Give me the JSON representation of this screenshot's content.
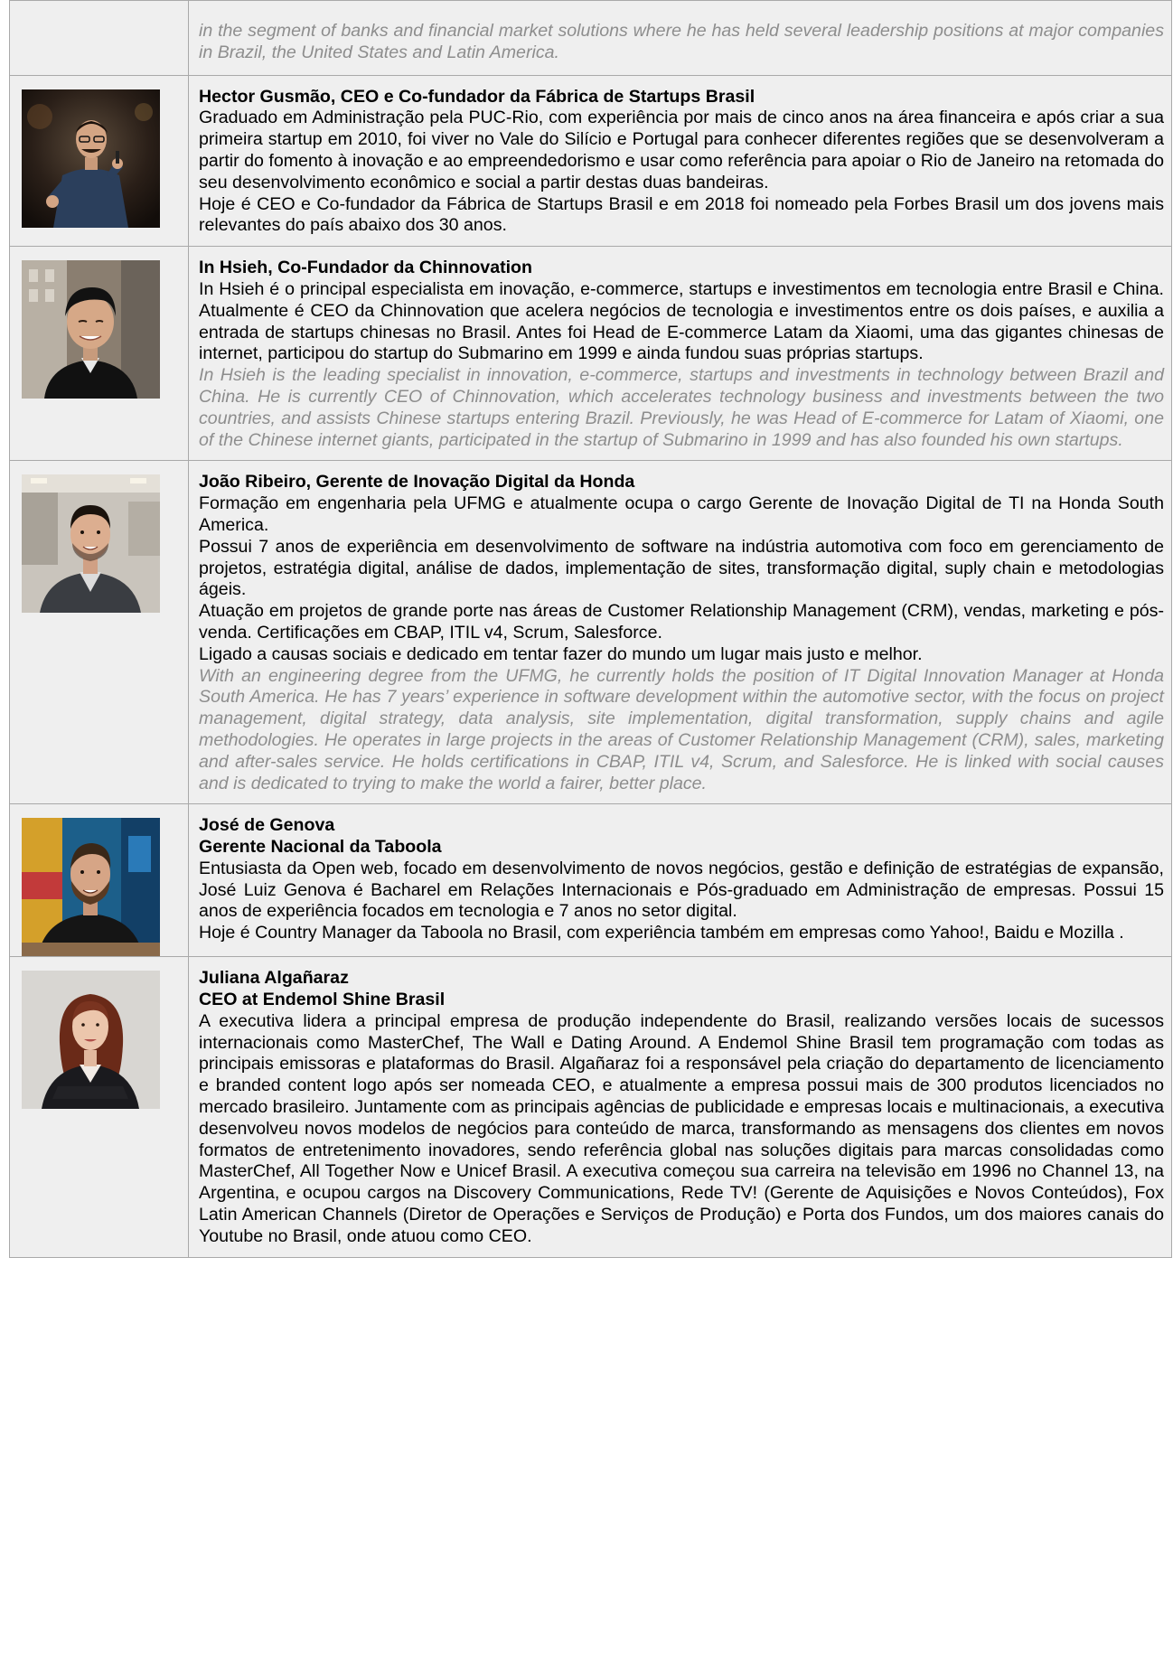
{
  "rows": [
    {
      "id": "continued",
      "english": "in the segment of banks and financial market solutions where he has held several leadership positions at major companies in Brazil, the United States and Latin America."
    },
    {
      "id": "hector",
      "photo": "person-portrait-hector",
      "name": "Hector Gusmão, CEO e Co-fundador da Fábrica de Startups Brasil",
      "bio": [
        "Graduado em Administração pela PUC-Rio, com experiência por mais de cinco anos na área financeira e após criar a sua primeira startup em 2010, foi viver no Vale do Silício e Portugal para conhecer diferentes regiões que se desenvolveram a partir do fomento à inovação e ao empreendedorismo e usar como referência para apoiar o Rio de Janeiro na retomada do seu desenvolvimento econômico e social a partir destas duas bandeiras.",
        "Hoje é CEO e Co-fundador da Fábrica de Startups Brasil e em 2018 foi nomeado pela Forbes Brasil um dos jovens mais relevantes do país abaixo dos 30 anos."
      ]
    },
    {
      "id": "inhsieh",
      "photo": "person-portrait-in-hsieh",
      "name": "In Hsieh, Co-Fundador da Chinnovation",
      "bio": [
        "In Hsieh é o principal especialista em inovação, e-commerce, startups e investimentos em tecnologia entre Brasil e China. Atualmente é CEO da Chinnovation que acelera negócios de tecnologia e investimentos entre os dois países, e auxilia a entrada de startups chinesas no Brasil. Antes foi Head de E-commerce Latam da Xiaomi, uma das gigantes chinesas de internet, participou do startup do Submarino em 1999 e ainda fundou suas próprias startups."
      ],
      "english": "In Hsieh is the leading specialist in innovation, e-commerce, startups and investments in technology between Brazil and China. He is currently CEO of Chinnovation, which accelerates technology business and investments between the two countries, and assists Chinese startups entering Brazil. Previously, he was Head of E-commerce for Latam of Xiaomi, one of the Chinese internet giants, participated in the startup of Submarino in 1999 and has also founded his own startups."
    },
    {
      "id": "joao",
      "photo": "person-portrait-joao-ribeiro",
      "name": "João Ribeiro, Gerente de Inovação Digital da Honda",
      "bio": [
        "Formação em engenharia pela UFMG e atualmente ocupa o cargo Gerente de Inovação Digital de TI na Honda South America.",
        "Possui 7 anos de experiência em desenvolvimento de software na indústria automotiva com foco  em gerenciamento de projetos, estratégia digital, análise de dados, implementação de sites, transformação digital, suply chain e metodologias ágeis.",
        "Atuação em projetos de grande porte nas áreas de Customer Relationship Management (CRM), vendas, marketing e pós-venda. Certificações em CBAP, ITIL v4, Scrum, Salesforce.",
        "Ligado a causas sociais e dedicado em tentar fazer do mundo um lugar mais justo e  melhor."
      ],
      "english": "With an engineering degree from the UFMG, he currently holds the position of IT Digital Innovation Manager at Honda South America. He has 7 years’ experience in software development within the automotive sector, with the focus on project management, digital strategy, data analysis, site implementation, digital transformation, supply chains and agile methodologies. He operates in large projects in the areas of Customer Relationship Management (CRM), sales, marketing and after-sales service. He holds certifications in CBAP, ITIL v4, Scrum, and Salesforce. He is linked with social causes and is dedicated to trying to make the world a fairer, better place."
    },
    {
      "id": "jose",
      "photo": "person-portrait-jose-de-genova",
      "name": "José de Genova",
      "title": "Gerente Nacional da Taboola",
      "bio": [
        "Entusiasta da Open web, focado em desenvolvimento de novos negócios, gestão e definição de estratégias de expansão, José Luiz Genova é Bacharel em Relações Internacionais e Pós-graduado em Administração de empresas. Possui 15 anos de experiência focados em tecnologia e 7 anos no setor digital.",
        "Hoje é Country Manager da Taboola no Brasil, com experiência também em empresas como Yahoo!, Baidu e Mozilla ."
      ]
    },
    {
      "id": "juliana",
      "photo": "person-portrait-juliana-alganaraz",
      "name": "Juliana Algañaraz",
      "title": "CEO at Endemol Shine Brasil",
      "bio": [
        "A executiva lidera a principal empresa de produção independente do Brasil, realizando versões locais de sucessos internacionais como MasterChef, The Wall e Dating Around. A Endemol Shine Brasil tem programação com todas as principais emissoras e plataformas do Brasil. Algañaraz foi a responsável pela criação do departamento de licenciamento e branded content logo após ser nomeada CEO, e atualmente a empresa possui mais de 300 produtos licenciados no mercado brasileiro. Juntamente com as principais agências de publicidade e empresas locais e multinacionais, a executiva desenvolveu novos modelos de negócios para conteúdo de marca, transformando as mensagens dos clientes em novos formatos de entretenimento inovadores, sendo referência global nas soluções digitais para marcas consolidadas como MasterChef, All Together Now e Unicef Brasil. A executiva começou sua carreira na televisão em 1996 no Channel 13, na Argentina, e ocupou cargos na Discovery Communications, Rede TV! (Gerente de Aquisições e Novos Conteúdos), Fox Latin American Channels (Diretor de Operações e Serviços de Produção) e Porta dos Fundos, um dos maiores canais do Youtube no Brasil, onde atuou como CEO."
      ]
    }
  ]
}
